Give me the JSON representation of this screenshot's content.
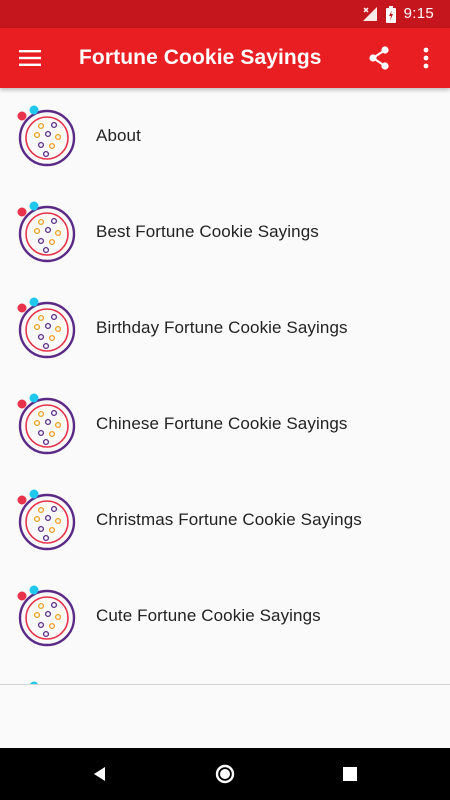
{
  "status_bar": {
    "time": "9:15"
  },
  "app_bar": {
    "title": "Fortune Cookie Sayings",
    "menu_icon": "hamburger-menu-icon",
    "share_icon": "share-icon",
    "more_icon": "more-vert-icon"
  },
  "list": {
    "items": [
      {
        "label": "About",
        "icon": "fortune-cookie-icon"
      },
      {
        "label": "Best Fortune Cookie Sayings",
        "icon": "fortune-cookie-icon"
      },
      {
        "label": "Birthday Fortune Cookie Sayings",
        "icon": "fortune-cookie-icon"
      },
      {
        "label": "Chinese Fortune Cookie Sayings",
        "icon": "fortune-cookie-icon"
      },
      {
        "label": "Christmas Fortune Cookie Sayings",
        "icon": "fortune-cookie-icon"
      },
      {
        "label": "Cute Fortune Cookie Sayings",
        "icon": "fortune-cookie-icon"
      }
    ]
  },
  "nav_bar": {
    "back_icon": "back-icon",
    "home_icon": "home-icon",
    "recents_icon": "recents-icon"
  },
  "colors": {
    "status_bar": "#c4161c",
    "app_bar": "#e91e22",
    "background": "#fafafa",
    "nav_bar": "#000000"
  }
}
